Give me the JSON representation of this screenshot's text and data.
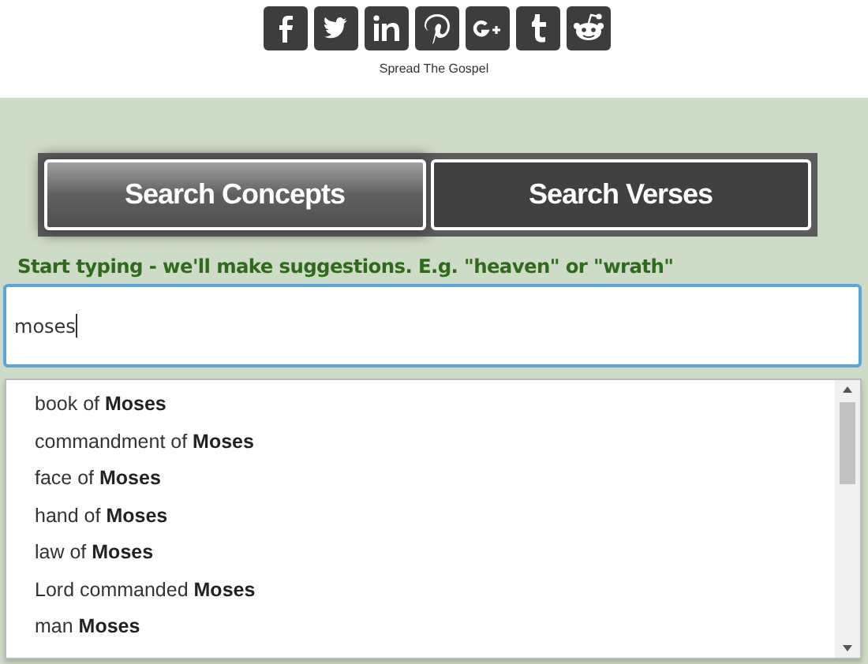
{
  "share": {
    "caption": "Spread The Gospel"
  },
  "tabs": [
    {
      "label": "Search Concepts",
      "selected": true
    },
    {
      "label": "Search Verses",
      "selected": false
    }
  ],
  "hint": "Start typing - we'll make suggestions. E.g. \"heaven\" or \"wrath\"",
  "search": {
    "value": "moses"
  },
  "suggestions": [
    "book of **Moses**",
    "commandment of **Moses**",
    "face of **Moses**",
    "hand of **Moses**",
    "law of **Moses**",
    "Lord commanded **Moses**",
    "man **Moses**"
  ]
}
